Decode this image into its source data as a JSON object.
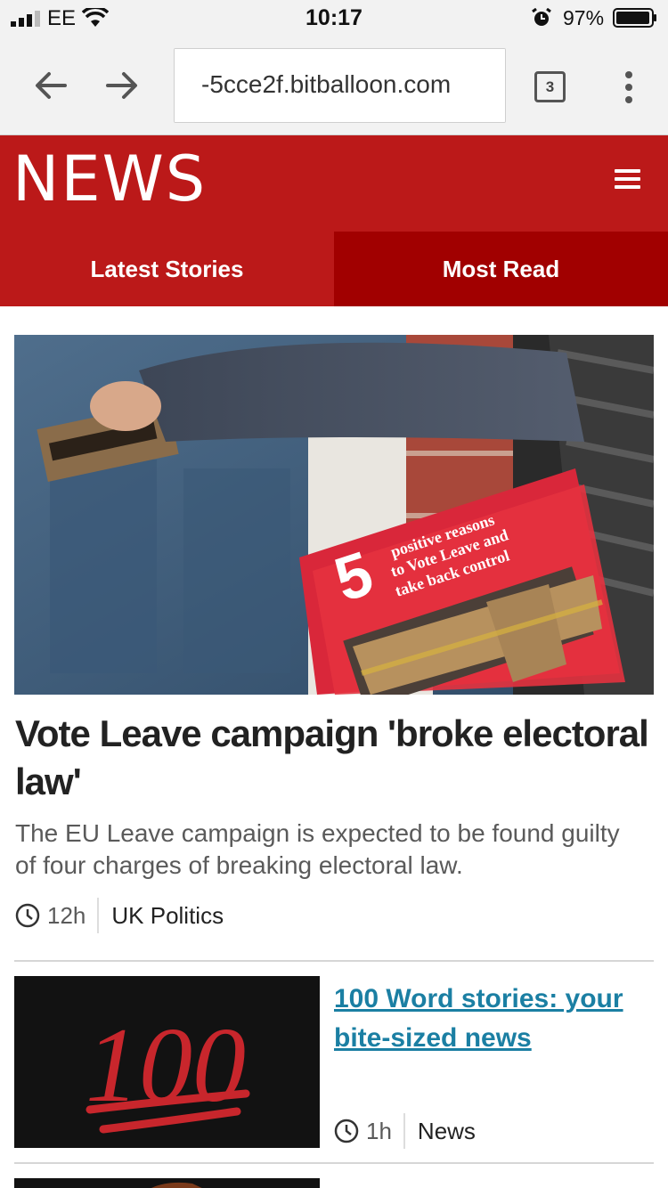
{
  "status_bar": {
    "carrier": "EE",
    "time": "10:17",
    "battery_percent": "97%"
  },
  "browser": {
    "url": "-5cce2f.bitballoon.com",
    "tab_count": "3"
  },
  "header": {
    "logo": "NEWS",
    "tabs": [
      {
        "label": "Latest Stories"
      },
      {
        "label": "Most Read"
      }
    ]
  },
  "top_story": {
    "headline": "Vote Leave campaign 'broke electoral law'",
    "summary": "The EU Leave campaign is expected to be found guilty of four charges of breaking electoral law.",
    "time": "12h",
    "section": "UK Politics",
    "image_leaflet_text": "5 positive reasons to Vote Leave and take back control"
  },
  "stories": [
    {
      "title": "100 Word stories: your bite-sized news",
      "time": "1h",
      "section": "News",
      "thumb_text": "100"
    }
  ],
  "colors": {
    "brand_red": "#bb1919",
    "tab_active": "#a10000",
    "link_blue": "#1b7fa3"
  }
}
